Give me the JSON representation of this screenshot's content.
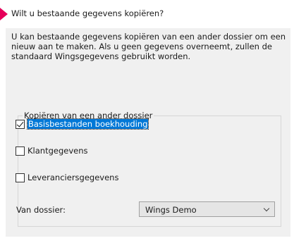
{
  "wizard": {
    "heading": "Wilt u bestaande gegevens kopiëren?",
    "description": "U kan bestaande gegevens kopiëren van een ander dossier om een nieuw aan te maken.  Als u geen gegevens overneemt, zullen de standaard Wingsgegevens gebruikt worden.",
    "accent_color": "#e6005a"
  },
  "group": {
    "legend": "Kopiëren van een ander dossier",
    "options": [
      {
        "label": "Basisbestanden boekhouding",
        "checked": true,
        "focused": true
      },
      {
        "label": "Klantgegevens",
        "checked": false,
        "focused": false
      },
      {
        "label": "Leveranciersgegevens",
        "checked": false,
        "focused": false
      }
    ],
    "dossier_label": "Van dossier:",
    "dossier_selected": "Wings Demo"
  }
}
